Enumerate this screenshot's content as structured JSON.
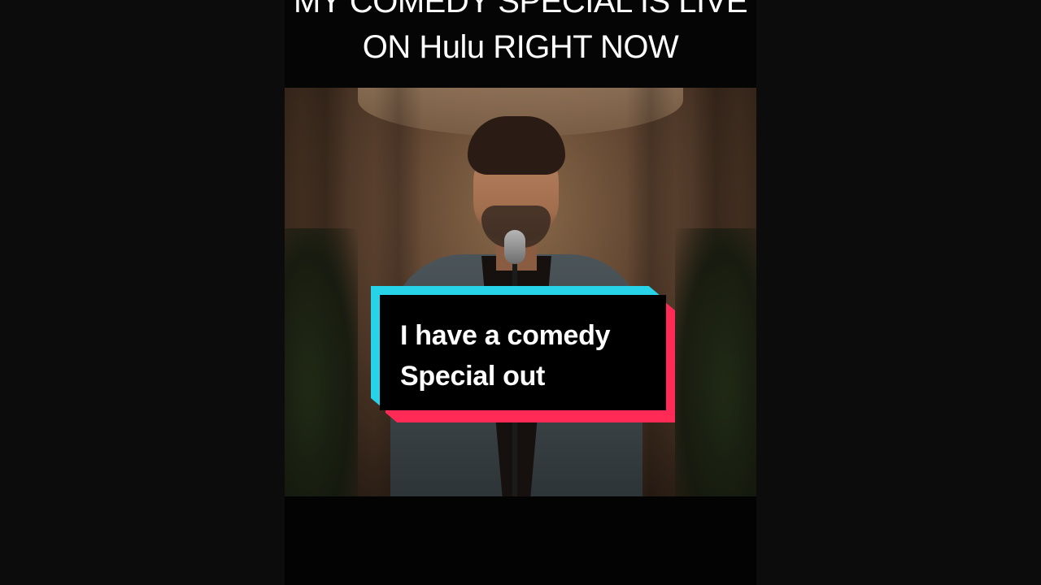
{
  "video": {
    "title_overlay": {
      "line1": "MY COMEDY SPECIAL IS LIVE",
      "line2": "ON Hulu RIGHT NOW"
    },
    "caption": {
      "line1": "I have a comedy",
      "line2": "Special out"
    }
  },
  "colors": {
    "caption_accent_cyan": "#27d3e8",
    "caption_accent_red": "#ff2a55",
    "caption_background": "#000000",
    "caption_text": "#ffffff"
  }
}
